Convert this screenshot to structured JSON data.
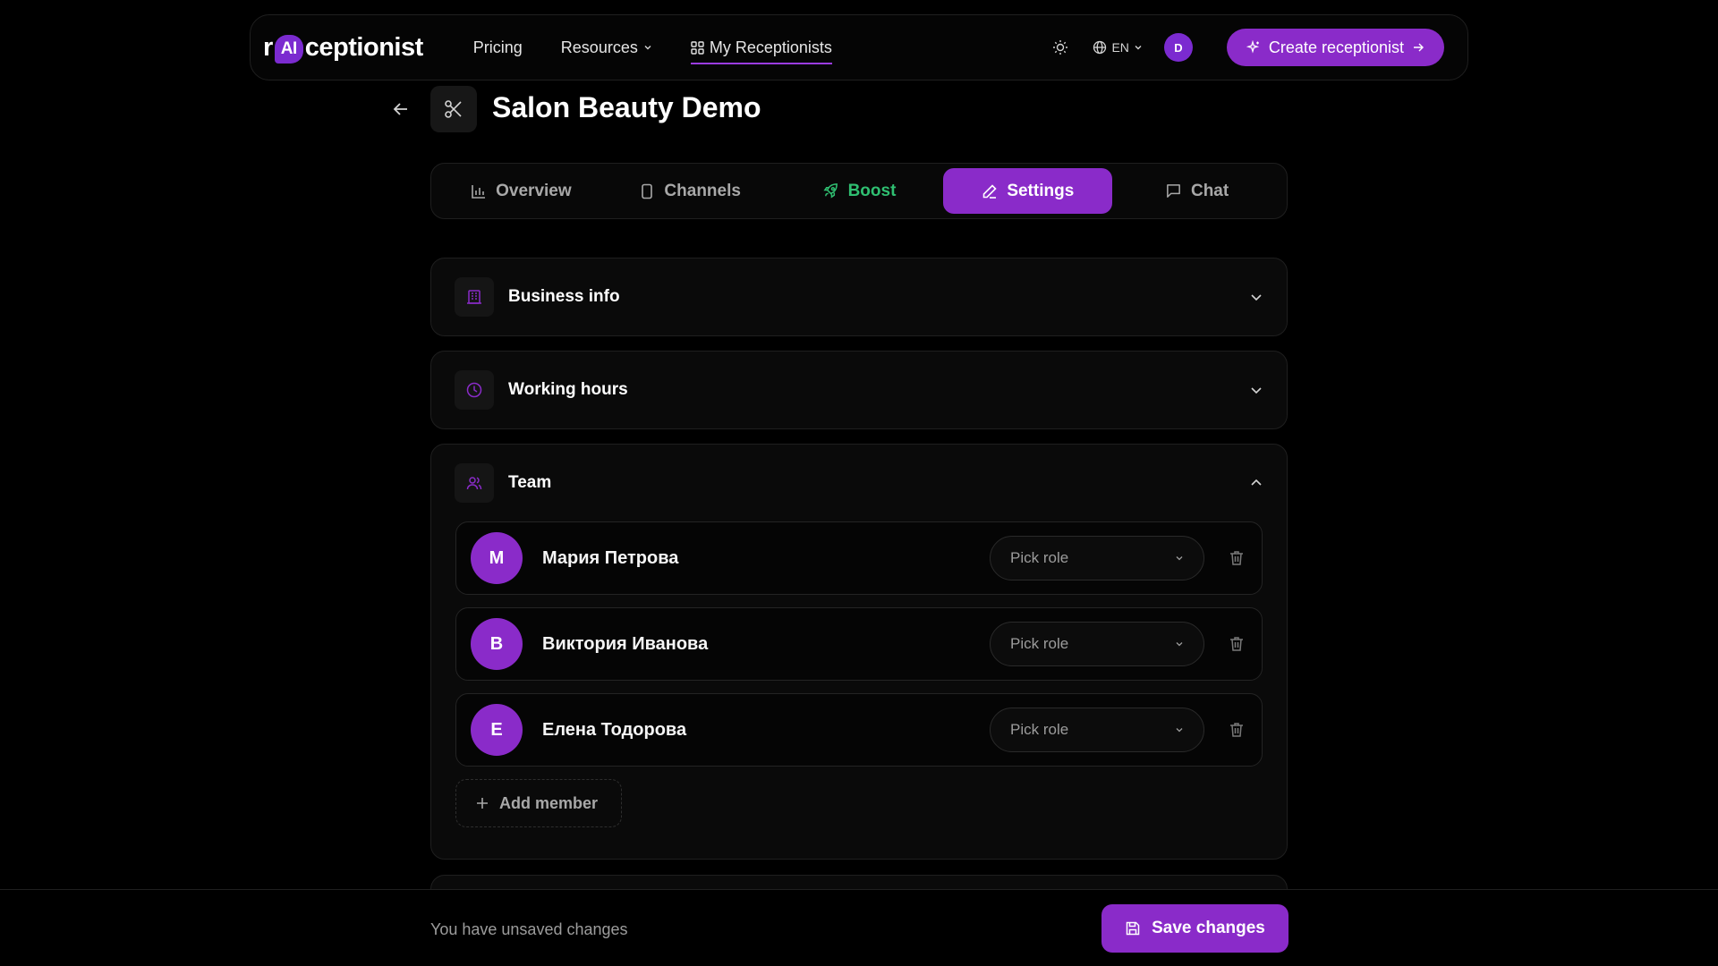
{
  "nav": {
    "logo_prefix": "r",
    "logo_ai": "AI",
    "logo_suffix": "ceptionist",
    "links": [
      {
        "label": "Pricing"
      },
      {
        "label": "Resources"
      },
      {
        "label": "My Receptionists"
      }
    ],
    "language": "EN",
    "avatar_initial": "D",
    "create_label": "Create receptionist"
  },
  "header": {
    "title": "Salon Beauty Demo",
    "icon": "scissors-icon"
  },
  "tabs": [
    {
      "label": "Overview",
      "icon": "bar-chart-icon"
    },
    {
      "label": "Channels",
      "icon": "phone-icon"
    },
    {
      "label": "Boost",
      "icon": "rocket-icon"
    },
    {
      "label": "Settings",
      "icon": "pencil-icon",
      "active": true
    },
    {
      "label": "Chat",
      "icon": "chat-icon"
    }
  ],
  "sections": {
    "business": {
      "title": "Business info",
      "icon": "building-icon"
    },
    "hours": {
      "title": "Working hours",
      "icon": "clock-icon"
    },
    "team": {
      "title": "Team",
      "icon": "users-icon",
      "members": [
        {
          "initial": "М",
          "name": "Мария Петрова",
          "role_placeholder": "Pick role"
        },
        {
          "initial": "В",
          "name": "Виктория Иванова",
          "role_placeholder": "Pick role"
        },
        {
          "initial": "Е",
          "name": "Елена Тодорова",
          "role_placeholder": "Pick role"
        }
      ],
      "add_label": "Add member"
    }
  },
  "footer": {
    "status": "You have unsaved changes",
    "save_label": "Save changes"
  },
  "colors": {
    "accent": "#8a2bc9",
    "boost": "#2fbf71",
    "background": "#000000"
  }
}
